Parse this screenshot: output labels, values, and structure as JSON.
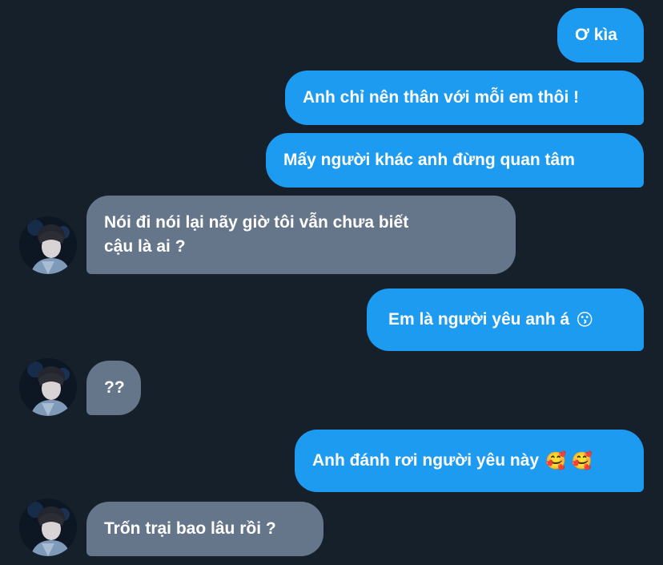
{
  "messages": [
    {
      "id": "m1",
      "side": "sent",
      "text": "Ơ kìa"
    },
    {
      "id": "m2",
      "side": "sent",
      "text": "Anh chỉ nên thân với mỗi em thôi !"
    },
    {
      "id": "m3",
      "side": "sent",
      "text": "Mấy người khác anh đừng quan tâm"
    },
    {
      "id": "m4",
      "side": "received",
      "line1": "Nói đi nói lại nãy giờ tôi vẫn chưa biết",
      "line2": "cậu là ai ?"
    },
    {
      "id": "m5",
      "side": "sent",
      "text": "Em là người yêu anh á",
      "emoji": "😗"
    },
    {
      "id": "m6",
      "side": "received",
      "text": "??"
    },
    {
      "id": "m7",
      "side": "sent",
      "text": "Anh đánh rơi người yêu này",
      "emoji": "🥰 🥰"
    },
    {
      "id": "m8",
      "side": "received",
      "text": "Trốn trại bao lâu rồi ?"
    }
  ],
  "colors": {
    "background": "#15202b",
    "sent_bubble": "#1d9bf0",
    "received_bubble": "#66768a",
    "text": "#ffffff"
  },
  "icons": {
    "avatar": "profile-photo-avatar-icon"
  }
}
